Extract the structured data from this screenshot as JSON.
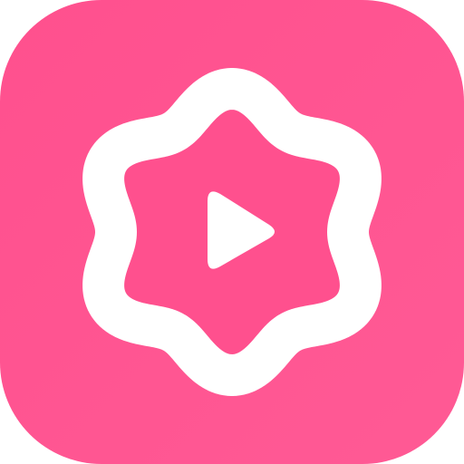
{
  "app_icon": {
    "icon": "play-badge-icon",
    "colors": {
      "background": "#FF508E",
      "background_light": "#FF5A95",
      "badge_outline": "#FFFFFF",
      "badge_fill": "#FF508E",
      "play_glyph": "#FFFFFF"
    }
  }
}
